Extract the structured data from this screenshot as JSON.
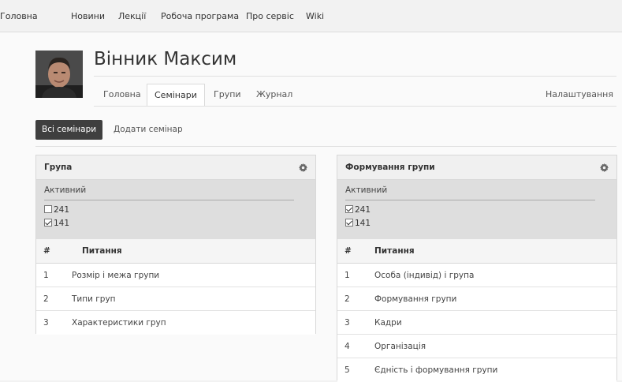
{
  "topnav": {
    "items": [
      "Головна",
      "Новини",
      "Лекції",
      "Робоча програма",
      "Про сервіс",
      "Wiki"
    ]
  },
  "profile": {
    "name": "Вінник Максим"
  },
  "subnav": {
    "tabs": [
      "Головна",
      "Семінари",
      "Групи",
      "Журнал"
    ],
    "active_index": 1,
    "settings": "Налаштування"
  },
  "seminar_tabs": {
    "items": [
      "Всі семінари",
      "Додати семінар"
    ],
    "active_index": 0
  },
  "panels": [
    {
      "title": "Група",
      "filter": {
        "label": "Активний",
        "options": [
          {
            "label": "241",
            "checked": false
          },
          {
            "label": "141",
            "checked": true
          }
        ]
      },
      "table": {
        "headers": [
          "#",
          "Питання"
        ],
        "rows": [
          [
            "1",
            "Розмір і межа групи"
          ],
          [
            "2",
            "Типи груп"
          ],
          [
            "3",
            "Характеристики груп"
          ]
        ]
      }
    },
    {
      "title": "Формування групи",
      "filter": {
        "label": "Активний",
        "options": [
          {
            "label": "241",
            "checked": true
          },
          {
            "label": "141",
            "checked": true
          }
        ]
      },
      "table": {
        "headers": [
          "#",
          "Питання"
        ],
        "rows": [
          [
            "1",
            "Особа (індивід) і група"
          ],
          [
            "2",
            "Формування групи"
          ],
          [
            "3",
            "Кадри"
          ],
          [
            "4",
            "Організація"
          ],
          [
            "5",
            "Єдність і формування групи"
          ]
        ]
      }
    }
  ],
  "icons": {
    "panel_settings": "gear-icon"
  },
  "colors": {
    "active_pill": "#3f3f3f",
    "page_bg": "#f2f2f2"
  }
}
